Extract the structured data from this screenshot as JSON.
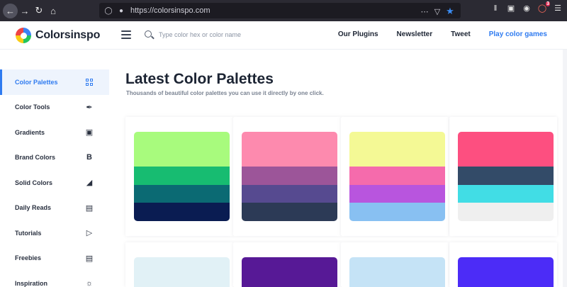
{
  "browser": {
    "url": "https://colorsinspo.com"
  },
  "site": {
    "logo_text": "Colorsinspo",
    "search_placeholder": "Type color hex or color name",
    "nav": [
      {
        "label": "Our Plugins"
      },
      {
        "label": "Newsletter"
      },
      {
        "label": "Tweet"
      },
      {
        "label": "Play color games",
        "accent": "#2f7bf0"
      }
    ]
  },
  "sidebar": {
    "items": [
      {
        "label": "Color Palettes",
        "icon": "grid-icon",
        "active": true
      },
      {
        "label": "Color Tools",
        "icon": "eyedropper-icon"
      },
      {
        "label": "Gradients",
        "icon": "image-icon"
      },
      {
        "label": "Brand Colors",
        "icon": "bold-b-icon"
      },
      {
        "label": "Solid Colors",
        "icon": "paint-bucket-icon"
      },
      {
        "label": "Daily Reads",
        "icon": "newspaper-icon"
      },
      {
        "label": "Tutorials",
        "icon": "play-icon"
      },
      {
        "label": "Freebies",
        "icon": "layout-icon"
      },
      {
        "label": "Inspiration",
        "icon": "sun-icon"
      }
    ]
  },
  "main": {
    "title": "Latest Color Palettes",
    "subtitle": "Thousands of beautiful color palettes you can use it directly by one click."
  },
  "palettes": [
    {
      "colors": [
        "#a8fb7d",
        "#17bc71",
        "#0b6a73",
        "#0a1c52"
      ]
    },
    {
      "colors": [
        "#fd8aae",
        "#9c5599",
        "#564a90",
        "#2c3a56"
      ]
    },
    {
      "colors": [
        "#f4f995",
        "#f56bac",
        "#b855de",
        "#88c0f2"
      ]
    },
    {
      "colors": [
        "#fd4f80",
        "#334b68",
        "#41dde5",
        "#efefef"
      ]
    },
    {
      "colors": [
        "#e1f1f6"
      ]
    },
    {
      "colors": [
        "#571996"
      ]
    },
    {
      "colors": [
        "#c5e3f6"
      ]
    },
    {
      "colors": [
        "#4c2cf7"
      ]
    }
  ]
}
